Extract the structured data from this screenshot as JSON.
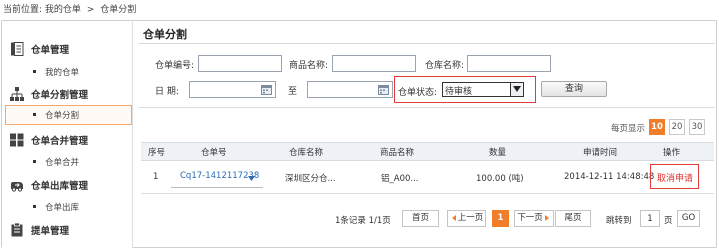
{
  "breadcrumb": {
    "prefix": "当前位置:",
    "level1": "我的仓单",
    "sep": ">",
    "level2": "仓单分割"
  },
  "sidebar": {
    "groups": [
      {
        "label": "仓单管理",
        "icon": "document-icon",
        "items": [
          {
            "label": "我的仓单"
          }
        ]
      },
      {
        "label": "仓单分割管理",
        "icon": "split-tree-icon",
        "items": [
          {
            "label": "仓单分割",
            "active": true
          }
        ]
      },
      {
        "label": "仓单合并管理",
        "icon": "merge-grid-icon",
        "items": [
          {
            "label": "仓单合并"
          }
        ]
      },
      {
        "label": "仓单出库管理",
        "icon": "truck-out-icon",
        "items": [
          {
            "label": "仓单出库"
          }
        ]
      },
      {
        "label": "提单管理",
        "icon": "clipboard-icon",
        "items": []
      }
    ]
  },
  "page": {
    "title": "仓单分割"
  },
  "search": {
    "order_no_label": "仓单编号:",
    "product_label": "商品名称:",
    "warehouse_label": "仓库名称:",
    "date_label": "日  期:",
    "date_to": "至",
    "status_label": "仓单状态:",
    "status_value": "待审核",
    "query_button": "查询"
  },
  "perpage": {
    "label": "每页显示",
    "options": [
      "10",
      "20",
      "30"
    ],
    "selected": "10"
  },
  "table": {
    "columns": [
      "序号",
      "仓单号",
      "仓库名称",
      "商品名称",
      "数量",
      "申请时间",
      "操作"
    ],
    "rows": [
      {
        "index": "1",
        "order_no": "Cq17-1412117238",
        "warehouse": "深圳区分仓...",
        "product": "铝_A00...",
        "quantity": "100.00 (吨)",
        "apply_time": "2014-12-11 14:48:48",
        "action": "取消申请"
      }
    ]
  },
  "pager": {
    "summary": "1条记录  1/1页",
    "first": "首页",
    "prev": "上一页",
    "current": "1",
    "next": "下一页",
    "last": "尾页",
    "jump_label": "跳转到",
    "jump_value": "1",
    "page_unit": "页",
    "go": "GO"
  },
  "colors": {
    "accent": "#f07d2a",
    "alert_border": "#e03c3c",
    "link": "#2a6bb5",
    "cancel": "#e0302f"
  }
}
